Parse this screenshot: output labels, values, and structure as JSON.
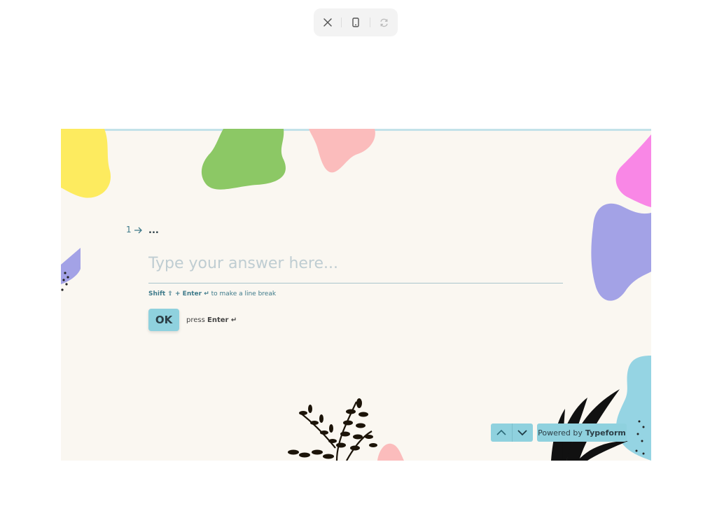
{
  "toolbar": {
    "close_icon": "close-icon",
    "device_icon": "mobile-device-icon",
    "refresh_icon": "refresh-icon"
  },
  "question": {
    "number": "1",
    "title": "...",
    "placeholder": "Type your answer here...",
    "hint_key": "Shift ⇧ + Enter ↵",
    "hint_text": "to make a line break",
    "ok_label": "OK",
    "press_text": "press",
    "press_key": "Enter ↵"
  },
  "footer": {
    "powered_text": "Powered by",
    "brand": "Typeform"
  },
  "colors": {
    "background": "#faf7f1",
    "accent": "#8fd1de",
    "text": "#2c3e46",
    "progress": "#c3e2e9"
  }
}
